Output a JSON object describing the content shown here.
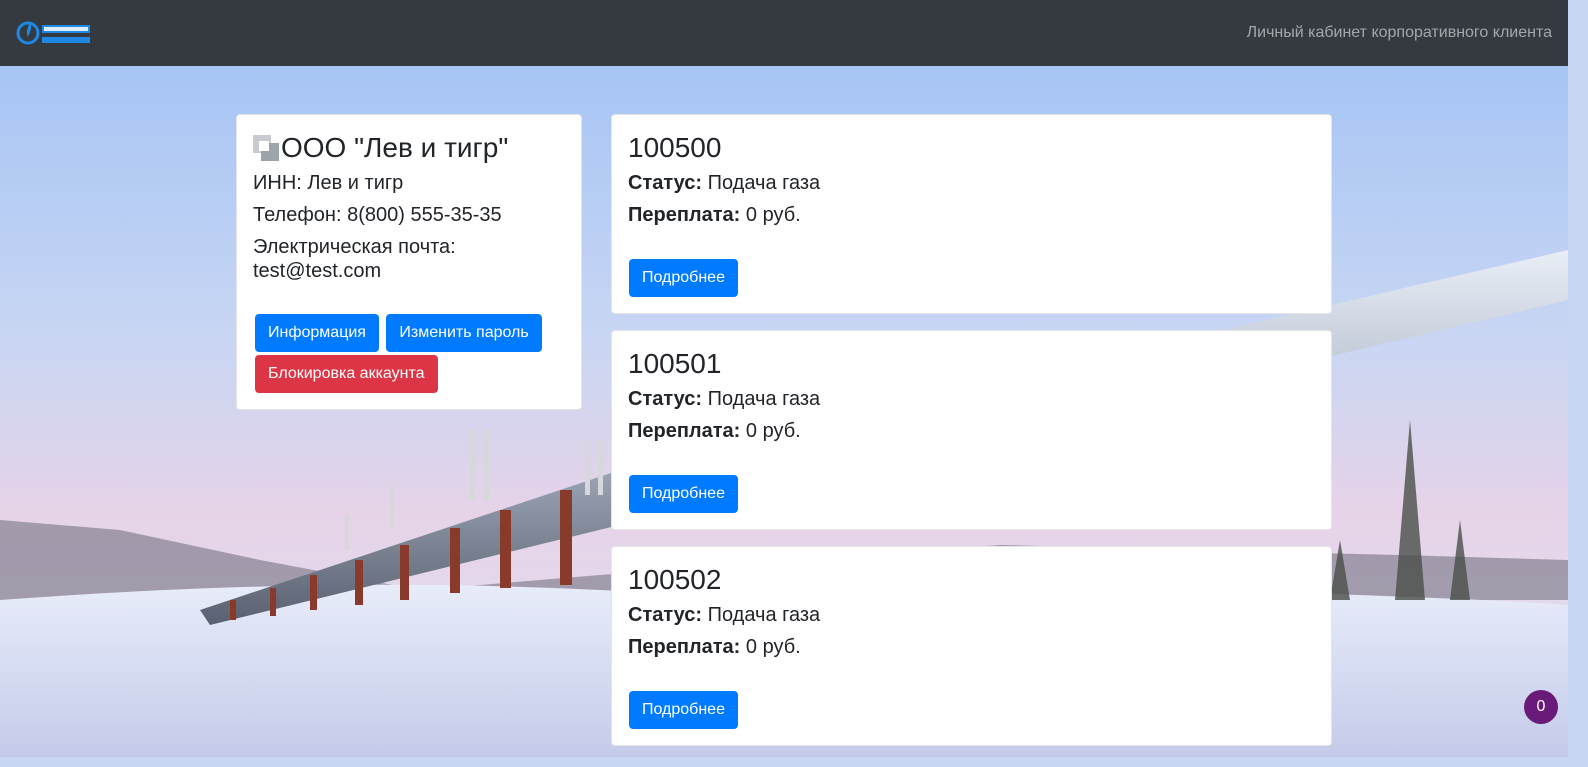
{
  "navbar": {
    "logo_icon": "gazprom-flame-logo",
    "title": "Личный кабинет корпоративного клиента"
  },
  "profile": {
    "company_name": "ООО \"Лев и тигр\"",
    "inn": "ИНН: Лев и тигр",
    "phone": "Телефон: 8(800) 555-35-35",
    "email_label": "Электрическая почта:",
    "email_value": "test@test.com",
    "info_button": "Информация",
    "change_password_button": "Изменить пароль",
    "block_button": "Блокировка аккаунта"
  },
  "accounts": [
    {
      "number": "100500",
      "status_label": "Статус:",
      "status_value": "Подача газа",
      "overpay_label": "Переплата:",
      "overpay_value": "0 руб.",
      "details_button": "Подробнее"
    },
    {
      "number": "100501",
      "status_label": "Статус:",
      "status_value": "Подача газа",
      "overpay_label": "Переплата:",
      "overpay_value": "0 руб.",
      "details_button": "Подробнее"
    },
    {
      "number": "100502",
      "status_label": "Статус:",
      "status_value": "Подача газа",
      "overpay_label": "Переплата:",
      "overpay_value": "0 руб.",
      "details_button": "Подробнее"
    }
  ],
  "notification_badge": "0",
  "colors": {
    "navbar": "#343a40",
    "primary": "#007bff",
    "danger": "#dc3545",
    "badge": "#6a1b7a"
  }
}
